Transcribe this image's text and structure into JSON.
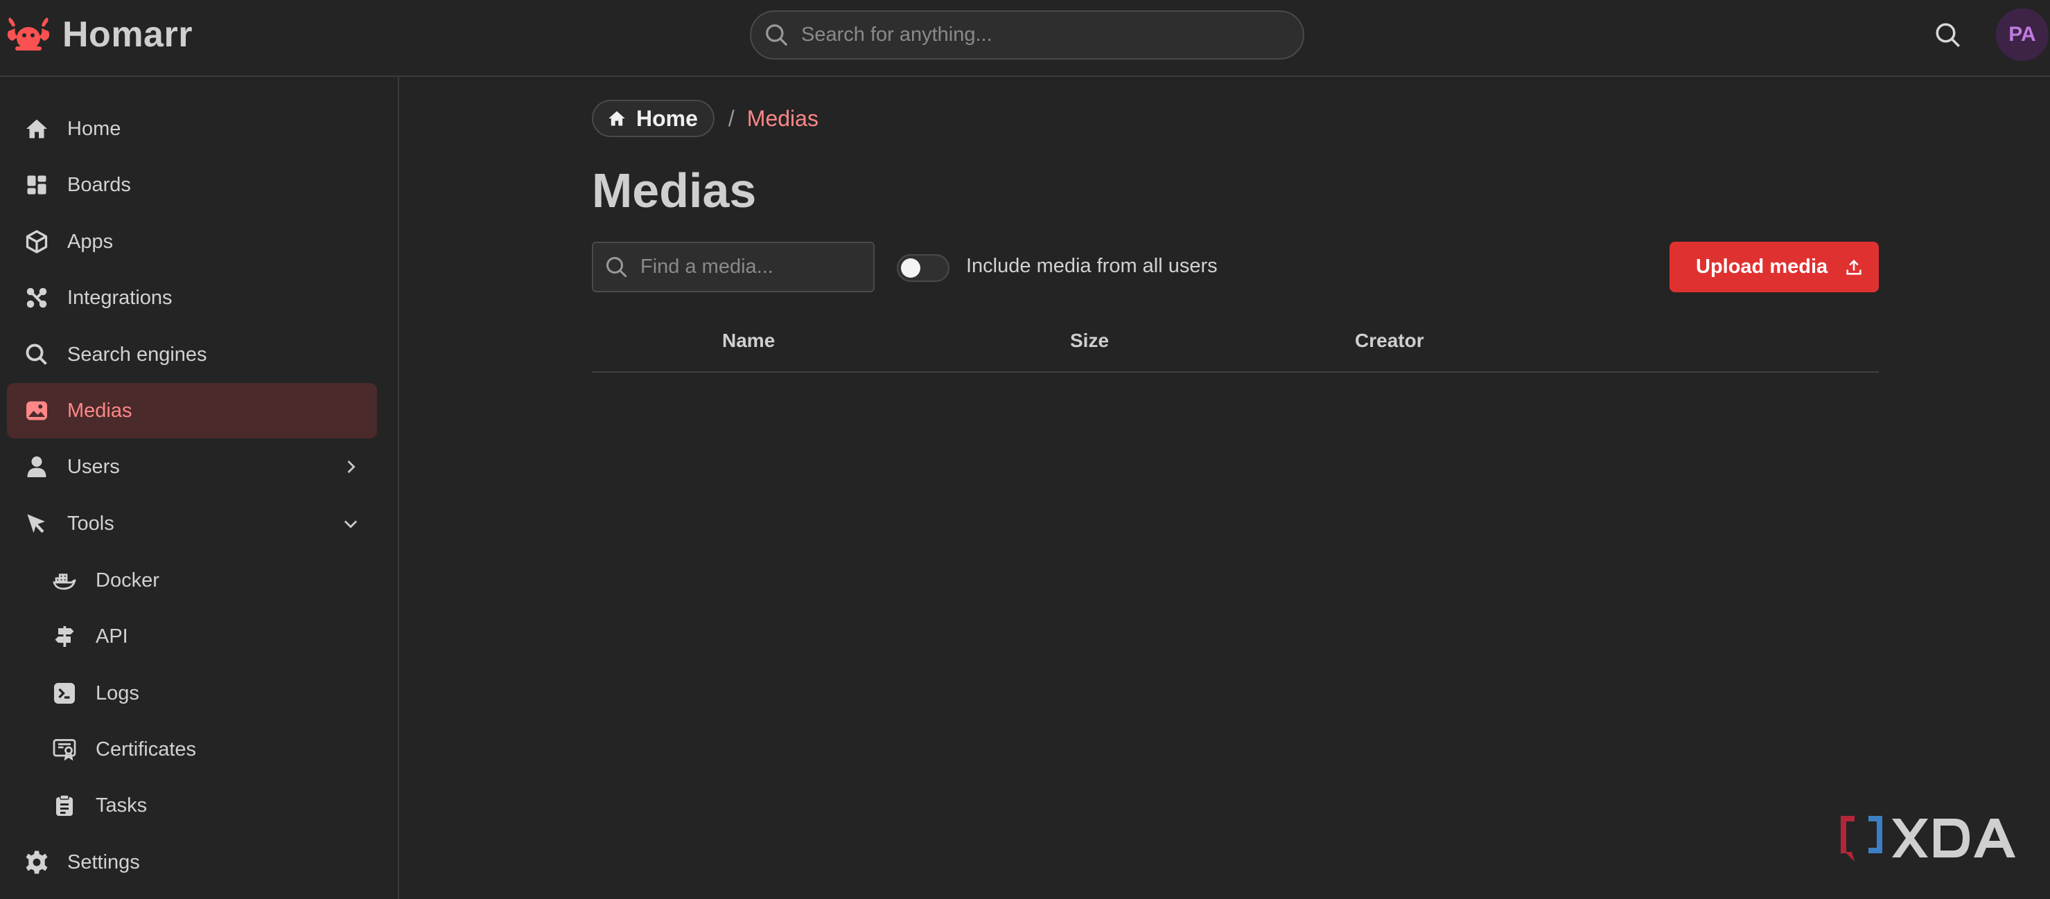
{
  "app": {
    "name": "Homarr"
  },
  "header": {
    "search_placeholder": "Search for anything...",
    "avatar_initials": "PA"
  },
  "sidebar": {
    "items": [
      {
        "label": "Home",
        "icon": "home-icon"
      },
      {
        "label": "Boards",
        "icon": "boards-icon"
      },
      {
        "label": "Apps",
        "icon": "box-icon"
      },
      {
        "label": "Integrations",
        "icon": "integrations-icon"
      },
      {
        "label": "Search engines",
        "icon": "search-icon"
      },
      {
        "label": "Medias",
        "icon": "photo-icon",
        "active": true
      },
      {
        "label": "Users",
        "icon": "user-icon",
        "chevron": "right"
      },
      {
        "label": "Tools",
        "icon": "pointer-icon",
        "chevron": "down"
      }
    ],
    "tools": [
      {
        "label": "Docker",
        "icon": "docker-icon"
      },
      {
        "label": "API",
        "icon": "api-icon"
      },
      {
        "label": "Logs",
        "icon": "terminal-icon"
      },
      {
        "label": "Certificates",
        "icon": "certificate-icon"
      },
      {
        "label": "Tasks",
        "icon": "clipboard-icon"
      }
    ],
    "settings": {
      "label": "Settings",
      "icon": "gear-icon"
    }
  },
  "breadcrumb": {
    "home": "Home",
    "separator": "/",
    "current": "Medias"
  },
  "page": {
    "title": "Medias",
    "search_placeholder": "Find a media...",
    "toggle_label": "Include media from all users",
    "toggle_on": false,
    "upload_label": "Upload media"
  },
  "table": {
    "columns": [
      "Name",
      "Size",
      "Creator"
    ]
  },
  "watermark": {
    "text": "XDA"
  },
  "colors": {
    "accent": "#e03131",
    "active_text": "#ff8787",
    "background": "#242424"
  }
}
